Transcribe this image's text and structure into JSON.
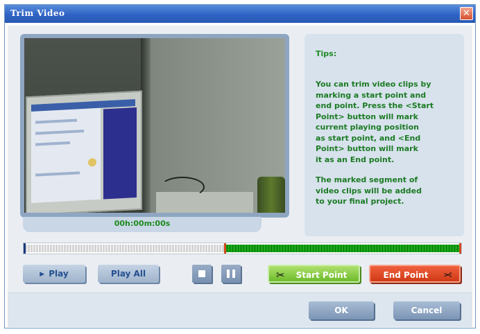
{
  "window": {
    "title": "Trim Video",
    "close_glyph": "✕"
  },
  "preview": {
    "timecode": "00h:00m:00s"
  },
  "tips": {
    "title": "Tips:",
    "paragraph1": "You can trim video clips by\nmarking a start point and\nend point. Press the <Start\nPoint> button will mark\ncurrent playing position\nas start point, and <End\nPoint> button will mark\nit as an End point.",
    "paragraph2": "The marked segment of\nvideo clips will be added\nto your final project."
  },
  "timeline": {
    "start_fraction": 0.46,
    "end_fraction": 1.0,
    "start_marker_color": "#1a3a7a",
    "selection_marker_color": "#d24b1e",
    "selected_color": "#18a818"
  },
  "controls": {
    "play_label": "Play",
    "play_icon": "play-icon",
    "play_all_label": "Play All",
    "stop_icon": "stop-icon",
    "pause_icon": "pause-icon",
    "start_point_label": "Start Point",
    "end_point_label": "End Point",
    "scissors_icon": "scissors-icon"
  },
  "dialog_buttons": {
    "ok_label": "OK",
    "cancel_label": "Cancel"
  },
  "colors": {
    "title_bar": "#2e63c4",
    "tips_text": "#1c7a24",
    "start_button": "#6dbb2b",
    "end_button": "#d03a16"
  }
}
